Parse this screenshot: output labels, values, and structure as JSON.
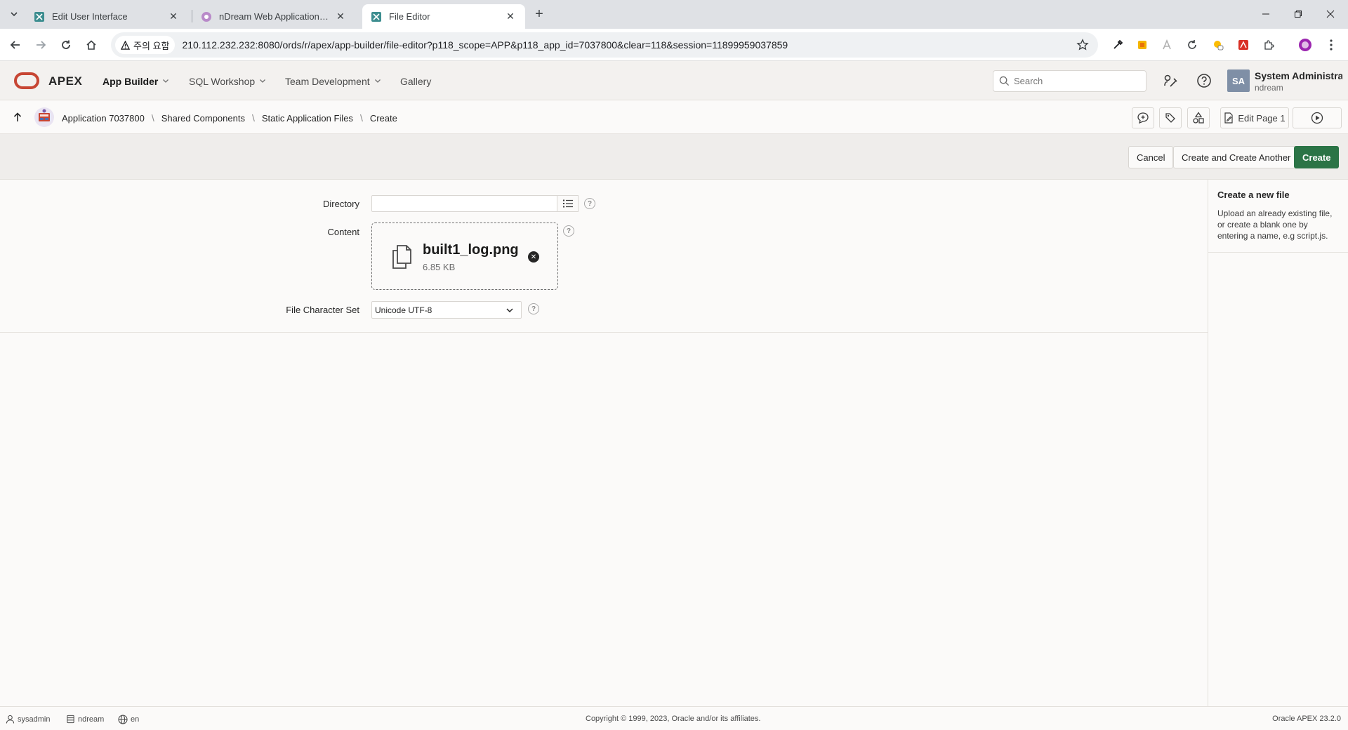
{
  "browser": {
    "tabs": [
      {
        "title": "Edit User Interface",
        "active": false
      },
      {
        "title": "nDream Web Application - Log In",
        "active": false
      },
      {
        "title": "File Editor",
        "active": true
      }
    ],
    "security_label": "주의 요함",
    "url": "210.112.232.232:8080/ords/r/apex/app-builder/file-editor?p118_scope=APP&p118_app_id=7037800&clear=118&session=11899959037859"
  },
  "apex": {
    "product_name": "APEX",
    "menu": [
      {
        "label": "App Builder",
        "active": true,
        "has_menu": true
      },
      {
        "label": "SQL Workshop",
        "active": false,
        "has_menu": true
      },
      {
        "label": "Team Development",
        "active": false,
        "has_menu": true
      },
      {
        "label": "Gallery",
        "active": false,
        "has_menu": false
      }
    ],
    "search_placeholder": "Search",
    "user": {
      "initials": "SA",
      "name": "System Administrator",
      "workspace": "ndream"
    }
  },
  "breadcrumb": {
    "items": [
      "Application 7037800",
      "Shared Components",
      "Static Application Files"
    ],
    "current": "Create",
    "edit_page_label": "Edit Page 1"
  },
  "actions": {
    "cancel": "Cancel",
    "create_another": "Create and Create Another",
    "create": "Create"
  },
  "form": {
    "directory_label": "Directory",
    "directory_value": "",
    "content_label": "Content",
    "file_name": "built1_log.png",
    "file_size": "6.85 KB",
    "charset_label": "File Character Set",
    "charset_value": "Unicode UTF-8"
  },
  "help_panel": {
    "title": "Create a new file",
    "text": "Upload an already existing file, or create a blank one by entering a name, e.g script.js."
  },
  "footer": {
    "user": "sysadmin",
    "workspace": "ndream",
    "language": "en",
    "copyright": "Copyright © 1999, 2023, Oracle and/or its affiliates.",
    "version": "Oracle APEX 23.2.0"
  },
  "colors": {
    "accent_primary": "#2b7446",
    "oracle_red": "#c74634",
    "avatar_bg": "#7f8fa6"
  }
}
